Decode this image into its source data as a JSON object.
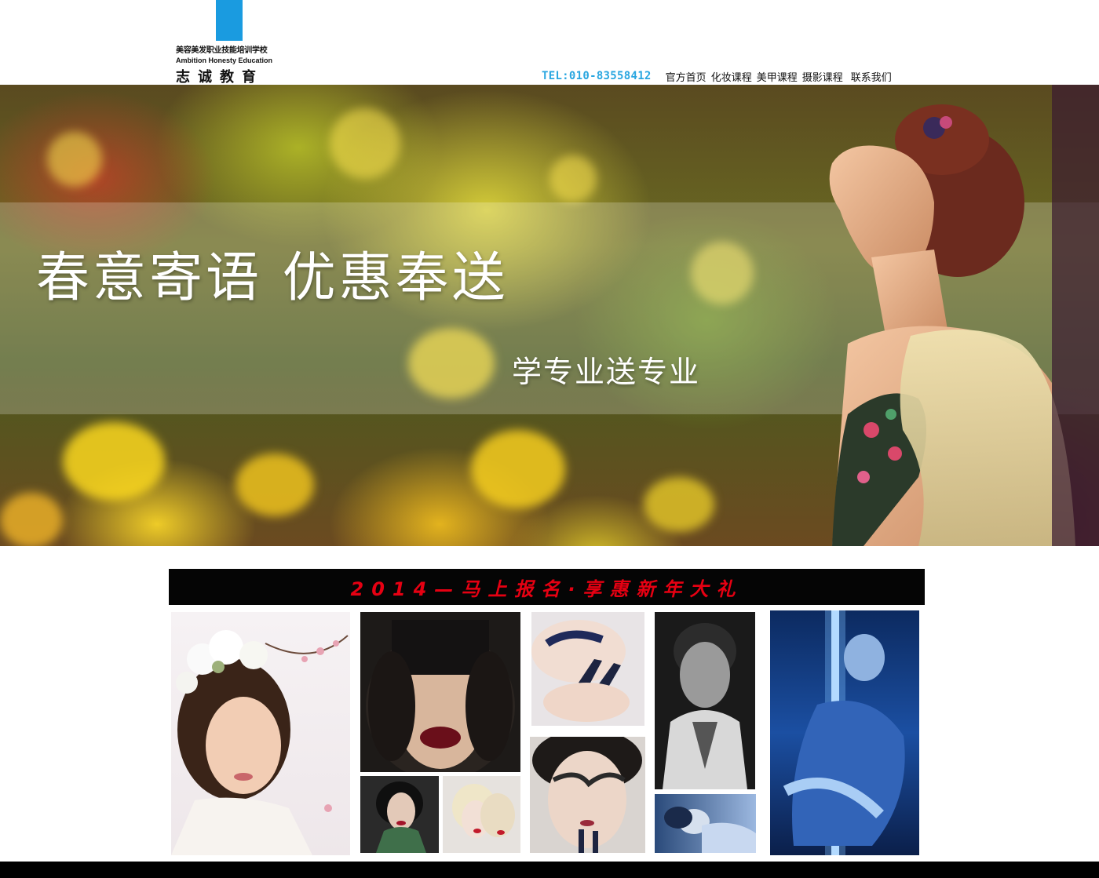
{
  "logo": {
    "school_name": "美容美发职业技能培训学校",
    "english_name": "Ambition Honesty Education",
    "brand": "志诚教育"
  },
  "nav": {
    "tel": "TEL:010-83558412",
    "items": [
      "官方首页",
      "化妆课程",
      "美甲课程",
      "摄影课程",
      "联系我们"
    ]
  },
  "banner": {
    "title": "春意寄语  优惠奉送",
    "subtitle": "学专业送专业"
  },
  "promo": {
    "text": "2014—马上报名·享惠新年大礼"
  },
  "colors": {
    "accent_blue": "#29a6e0",
    "logo_blue": "#1a9be0",
    "promo_red": "#e60012",
    "promo_bg": "#050505"
  }
}
